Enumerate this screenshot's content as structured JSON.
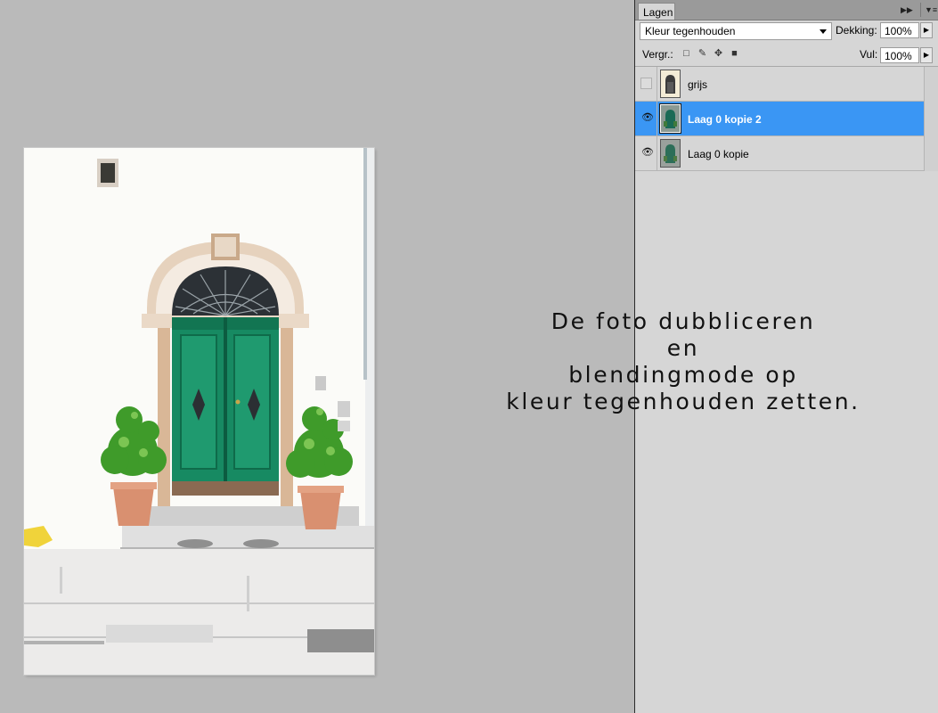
{
  "panel": {
    "tab_label": "Lagen",
    "collapse_icon": "double-chevron-right-icon",
    "menu_icon": "panel-menu-icon",
    "blend_mode": "Kleur tegenhouden",
    "opacity_label": "Dekking:",
    "opacity_value": "100%",
    "lock_label": "Vergr.:",
    "lock_icons": [
      "lock-transparent-icon",
      "lock-paint-icon",
      "lock-move-icon",
      "lock-all-icon"
    ],
    "fill_label": "Vul:",
    "fill_value": "100%",
    "layers": [
      {
        "name": "grijs",
        "visible": false,
        "selected": false
      },
      {
        "name": "Laag 0 kopie 2",
        "visible": true,
        "selected": true
      },
      {
        "name": "Laag 0 kopie",
        "visible": true,
        "selected": false
      }
    ],
    "selection_color": "#3a96f4"
  },
  "caption": {
    "lines": [
      "De foto dubbliceren",
      "en",
      "blendingmode op",
      "kleur tegenhouden zetten."
    ]
  },
  "canvas": {
    "background": "#bababa",
    "image_subject": "green double door with arched iron fanlight and potted plants"
  }
}
